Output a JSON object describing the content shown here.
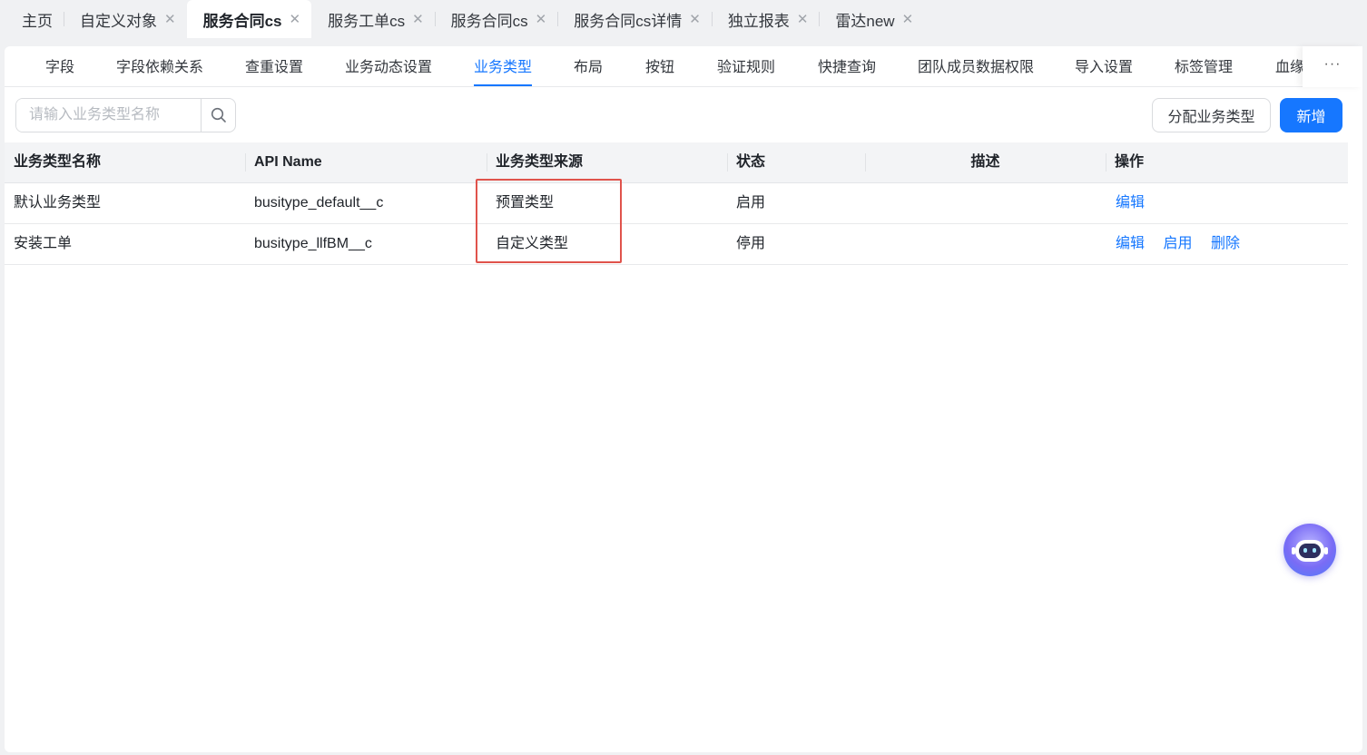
{
  "page_tabs": [
    {
      "label": "主页",
      "closable": false
    },
    {
      "label": "自定义对象",
      "closable": true
    },
    {
      "label": "服务合同cs",
      "closable": true,
      "active": true
    },
    {
      "label": "服务工单cs",
      "closable": true
    },
    {
      "label": "服务合同cs",
      "closable": true
    },
    {
      "label": "服务合同cs详情",
      "closable": true
    },
    {
      "label": "独立报表",
      "closable": true
    },
    {
      "label": "雷达new",
      "closable": true
    }
  ],
  "sub_tabs": [
    "字段",
    "字段依赖关系",
    "查重设置",
    "业务动态设置",
    "业务类型",
    "布局",
    "按钮",
    "验证规则",
    "快捷查询",
    "团队成员数据权限",
    "导入设置",
    "标签管理",
    "血缘"
  ],
  "active_sub_tab": "业务类型",
  "more_label": "···",
  "toolbar": {
    "search_placeholder": "请输入业务类型名称",
    "search_value": "",
    "assign_label": "分配业务类型",
    "new_label": "新增"
  },
  "table": {
    "columns": [
      "业务类型名称",
      "API Name",
      "业务类型来源",
      "状态",
      "描述",
      "操作"
    ],
    "rows": [
      {
        "name": "默认业务类型",
        "api_name": "busitype_default__c",
        "source": "预置类型",
        "status": "启用",
        "description": "",
        "actions": [
          "编辑"
        ]
      },
      {
        "name": "安装工单",
        "api_name": "busitype_llfBM__c",
        "source": "自定义类型",
        "status": "停用",
        "description": "",
        "actions": [
          "编辑",
          "启用",
          "删除"
        ]
      }
    ]
  },
  "colors": {
    "accent": "#1677ff",
    "highlight": "#e0534c"
  }
}
